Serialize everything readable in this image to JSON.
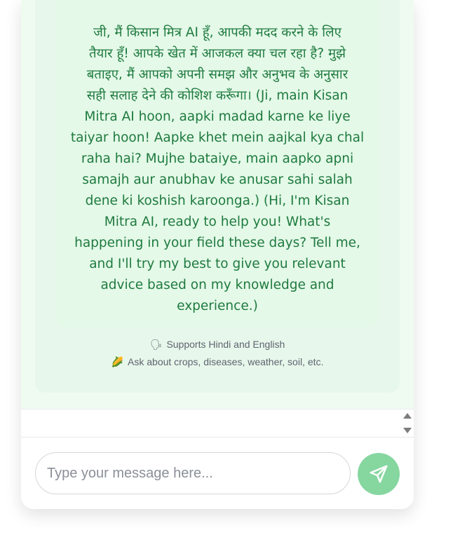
{
  "bot_message": {
    "lines": [
      "जी, मैं किसान मित्र AI हूँ, आपकी मदद करने के लिए",
      "तैयार हूँ! आपके खेत में आजकल क्या चल रहा है? मुझे",
      "बताइए, मैं आपको अपनी समझ और अनुभव के अनुसार",
      "सही सलाह देने की कोशिश करूँगा। (Ji, main Kisan",
      "Mitra AI hoon, aapki madad karne ke liye",
      "taiyar hoon! Aapke khet mein aajkal kya chal",
      "raha hai? Mujhe bataiye, main aapko apni",
      "samajh aur anubhav ke anusar sahi salah",
      "dene ki koshish karoonga.) (Hi, I'm Kisan",
      "Mitra AI, ready to help you! What's",
      "happening in your field these days? Tell me,",
      "and I'll try my best to give you relevant",
      "advice based on my knowledge and",
      "experience.)"
    ]
  },
  "hints": {
    "language": {
      "icon": "speaking-head-icon",
      "glyph": "🗣",
      "text": "Supports Hindi and English"
    },
    "topics": {
      "icon": "corn-icon",
      "glyph": "🌽",
      "text": "Ask about crops, diseases, weather, soil, etc."
    }
  },
  "input": {
    "value": "",
    "placeholder": "Type your message here..."
  },
  "send": {
    "icon": "send-icon"
  },
  "colors": {
    "bot_text": "#1f7a3f",
    "bubble_bg": "#e4f9e8",
    "send_button": "#86d6a0"
  }
}
